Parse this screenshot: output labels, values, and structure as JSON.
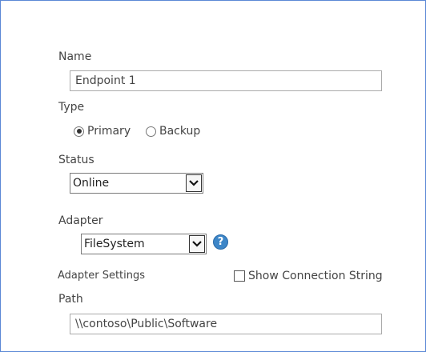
{
  "form": {
    "name": {
      "label": "Name",
      "value": "Endpoint 1"
    },
    "type": {
      "label": "Type",
      "options": [
        "Primary",
        "Backup"
      ],
      "selected": "Primary"
    },
    "status": {
      "label": "Status",
      "value": "Online"
    },
    "adapter": {
      "label": "Adapter",
      "value": "FileSystem",
      "help_icon": "help-icon",
      "help_glyph": "?"
    },
    "adapter_settings": {
      "label": "Adapter Settings",
      "show_connection_string_label": "Show Connection String",
      "show_connection_string_checked": false
    },
    "path": {
      "label": "Path",
      "value": "\\\\contoso\\Public\\Software"
    }
  },
  "colors": {
    "border": "#5b88d6",
    "help_blue": "#3d86c8",
    "text": "#444444"
  }
}
